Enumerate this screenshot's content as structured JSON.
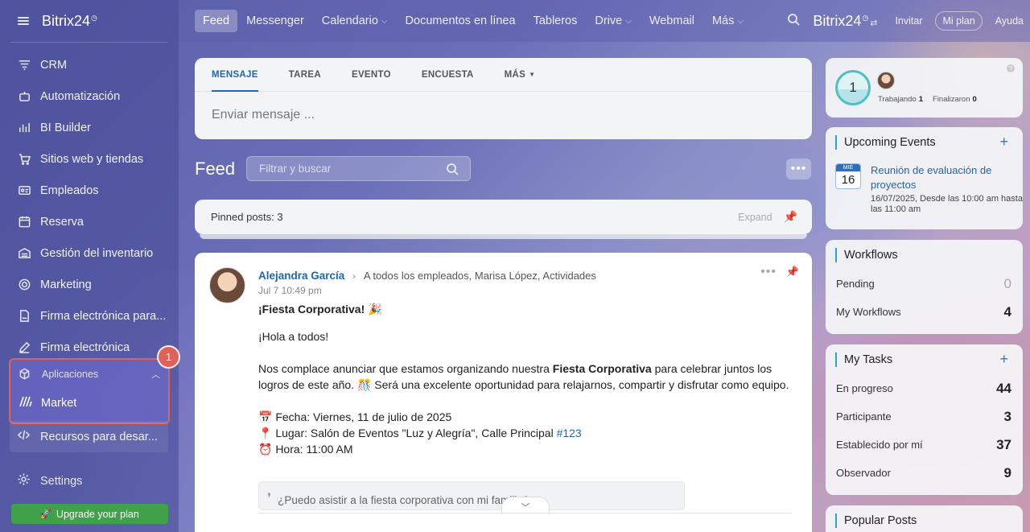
{
  "sidebar": {
    "logo": "Bitrix24",
    "items": [
      {
        "label": "CRM",
        "icon": "crm-funnel-icon"
      },
      {
        "label": "Automatización",
        "icon": "robot-icon"
      },
      {
        "label": "BI Builder",
        "icon": "bar-chart-icon"
      },
      {
        "label": "Sitios web y tiendas",
        "icon": "cart-icon"
      },
      {
        "label": "Empleados",
        "icon": "id-card-icon"
      },
      {
        "label": "Reserva",
        "icon": "calendar-icon"
      },
      {
        "label": "Gestión del inventario",
        "icon": "warehouse-icon"
      },
      {
        "label": "Marketing",
        "icon": "target-icon"
      },
      {
        "label": "Firma electrónica para...",
        "icon": "document-sign-icon"
      },
      {
        "label": "Firma electrónica",
        "icon": "pen-icon"
      }
    ],
    "group": {
      "label": "Aplicaciones",
      "child": "Market",
      "badge": "1"
    },
    "resources": "Recursos para desar...",
    "settings": "Settings",
    "upgrade": "Upgrade your plan"
  },
  "topbar": {
    "tabs": [
      {
        "label": "Feed",
        "active": true
      },
      {
        "label": "Messenger"
      },
      {
        "label": "Calendario",
        "caret": true
      },
      {
        "label": "Documentos en línea"
      },
      {
        "label": "Tableros"
      },
      {
        "label": "Drive",
        "caret": true
      },
      {
        "label": "Webmail"
      },
      {
        "label": "Más",
        "caret": true
      }
    ],
    "logo": "Bitrix24",
    "invite": "Invitar",
    "plan": "Mi plan",
    "help": "Ayuda"
  },
  "composer": {
    "tabs": [
      "MENSAJE",
      "TAREA",
      "EVENTO",
      "ENCUESTA",
      "MÁS"
    ],
    "placeholder": "Enviar mensaje ..."
  },
  "feed": {
    "title": "Feed",
    "filter_placeholder": "Filtrar y buscar",
    "pinned": "Pinned posts: 3",
    "expand": "Expand"
  },
  "post": {
    "author": "Alejandra García",
    "recipients": "A todos los empleados, Marisa López, Actividades",
    "date": "Jul 7 10:49 pm",
    "title": "¡Fiesta Corporativa! 🎉",
    "greeting": "¡Hola a todos!",
    "p1_a": "Nos complace anunciar que estamos organizando nuestra ",
    "p1_b": "Fiesta Corporativa",
    "p1_c": " para celebrar juntos los logros de este año. 🎊 Será una excelente oportunidad para relajarnos, compartir y disfrutar como equipo.",
    "fecha": "📅 Fecha: Viernes, 11 de julio de 2025",
    "lugar": "📍 Lugar: Salón de Eventos \"Luz y Alegría\", Calle Principal ",
    "lugar_tag": "#123",
    "hora": "⏰ Hora: 11:00 AM",
    "comment": "¿Puedo asistir a la fiesta corporativa con mi familia?"
  },
  "workday": {
    "count": "1",
    "working_label": "Trabajando",
    "working": "1",
    "done_label": "Finalizaron",
    "done": "0"
  },
  "events": {
    "title": "Upcoming Events",
    "cal_month": "MIÉ",
    "cal_day": "16",
    "event_title": "Reunión de evaluación de proyectos",
    "event_meta": "16/07/2025, Desde las 10:00 am hasta las 11:00 am"
  },
  "workflows": {
    "title": "Workflows",
    "rows": [
      {
        "label": "Pending",
        "value": "0"
      },
      {
        "label": "My Workflows",
        "value": "4"
      }
    ]
  },
  "tasks": {
    "title": "My Tasks",
    "rows": [
      {
        "label": "En progreso",
        "value": "44"
      },
      {
        "label": "Participante",
        "value": "3"
      },
      {
        "label": "Establecido por mí",
        "value": "37"
      },
      {
        "label": "Observador",
        "value": "9"
      }
    ]
  },
  "popular": {
    "title": "Popular Posts"
  }
}
